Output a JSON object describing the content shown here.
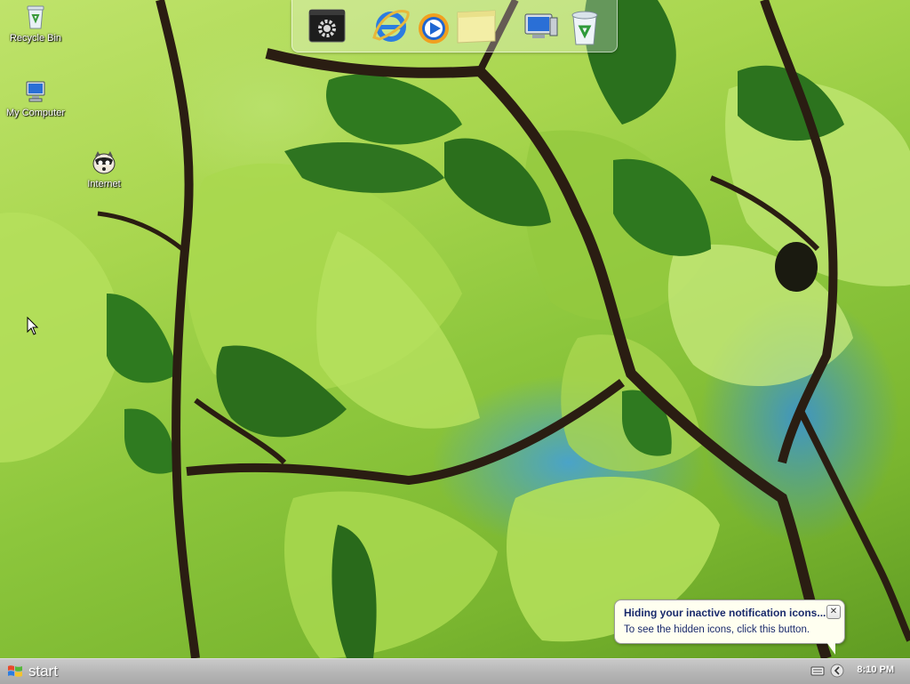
{
  "desktop": {
    "icons": [
      {
        "label": "Recycle Bin",
        "icon": "recycle-bin-icon"
      },
      {
        "label": "My Computer",
        "icon": "computer-icon"
      },
      {
        "label": "Internet",
        "icon": "internet-icon"
      }
    ]
  },
  "dock": {
    "items": [
      {
        "icon": "settings-icon"
      },
      {
        "icon": "internet-explorer-icon"
      },
      {
        "icon": "media-player-icon"
      },
      {
        "icon": "notes-icon"
      },
      {
        "icon": "computer-icon"
      },
      {
        "icon": "recycle-bin-icon"
      }
    ]
  },
  "taskbar": {
    "start_label": "start",
    "clock": "8:10 PM"
  },
  "balloon": {
    "title": "Hiding your inactive notification icons...",
    "body": "To see the hidden icons, click this button."
  },
  "colors": {
    "taskbar": "#b7b7b7",
    "balloon_bg": "#fffff0",
    "balloon_text": "#1a2a6c"
  }
}
